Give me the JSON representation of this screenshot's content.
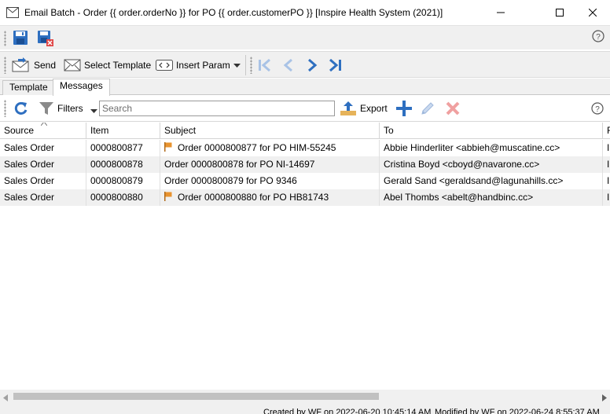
{
  "window": {
    "title": "Email Batch - Order {{ order.orderNo }} for PO {{ order.customerPO }} [Inspire Health System (2021)]"
  },
  "toolbar": {
    "send_label": "Send",
    "select_template_label": "Select Template",
    "insert_param_label": "Insert Param"
  },
  "tabs": [
    {
      "label": "Template",
      "active": false
    },
    {
      "label": "Messages",
      "active": true
    }
  ],
  "grid_toolbar": {
    "filters_label": "Filters",
    "search_placeholder": "Search",
    "export_label": "Export"
  },
  "columns": [
    "Source",
    "Item",
    "Subject",
    "To",
    "F"
  ],
  "rows": [
    {
      "source": "Sales Order",
      "item": "0000800877",
      "subject": "Order 0000800877 for PO HIM-55245",
      "flag": true,
      "to": "Abbie Hinderliter <abbieh@muscatine.cc>",
      "from": "In"
    },
    {
      "source": "Sales Order",
      "item": "0000800878",
      "subject": "Order 0000800878 for PO NI-14697",
      "flag": false,
      "to": "Cristina Boyd <cboyd@navarone.cc>",
      "from": "In"
    },
    {
      "source": "Sales Order",
      "item": "0000800879",
      "subject": "Order 0000800879 for PO 9346",
      "flag": false,
      "to": "Gerald Sand <geraldsand@lagunahills.cc>",
      "from": "In"
    },
    {
      "source": "Sales Order",
      "item": "0000800880",
      "subject": "Order 0000800880 for PO HB81743",
      "flag": true,
      "to": "Abel Thombs <abelt@handbinc.cc>",
      "from": "In"
    }
  ],
  "status": {
    "created": "Created by WF on 2022-06-20 10:45:14 AM",
    "modified": "Modified by WF on 2022-06-24 8:55:37 AM"
  },
  "colors": {
    "accent_blue": "#2e6fc0",
    "flag_orange": "#e8932f",
    "delete_red": "#f0a0a0",
    "row_alt": "#f0f0f0"
  }
}
